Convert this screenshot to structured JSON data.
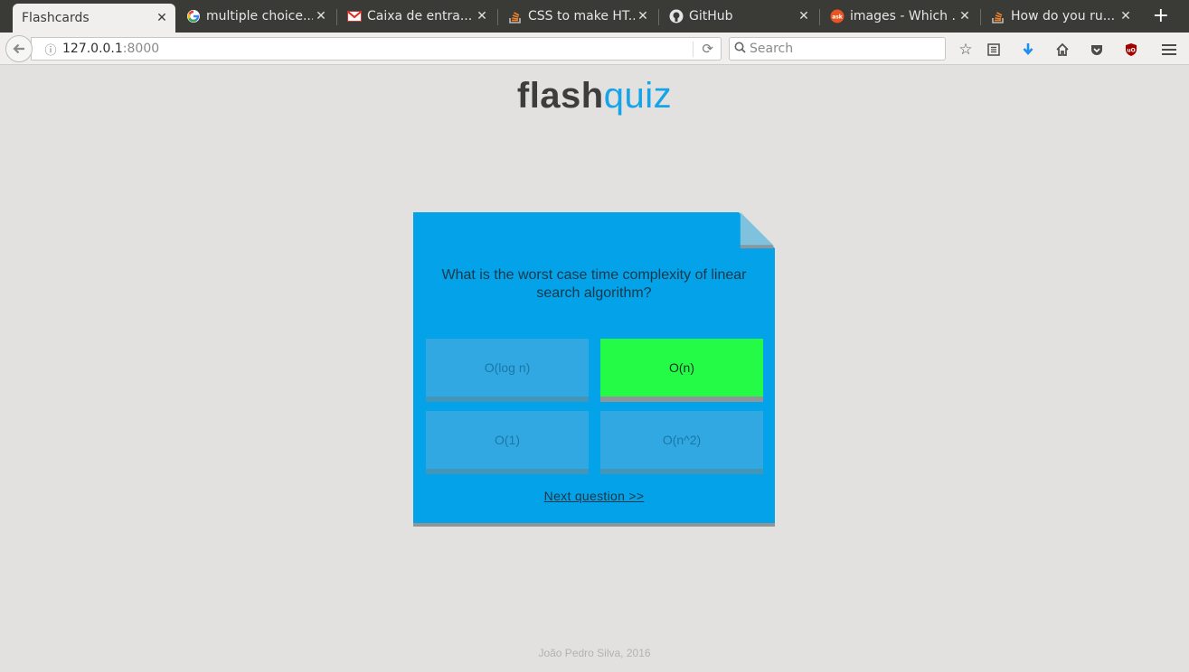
{
  "browser": {
    "tabs": [
      {
        "title": "Flashcards",
        "favicon": "none",
        "active": true
      },
      {
        "title": "multiple choice...",
        "favicon": "google-icon"
      },
      {
        "title": "Caixa de entra...",
        "favicon": "gmail-icon"
      },
      {
        "title": "CSS to make HT...",
        "favicon": "stackoverflow-icon"
      },
      {
        "title": "GitHub",
        "favicon": "github-icon"
      },
      {
        "title": "images - Which ...",
        "favicon": "askubuntu-icon"
      },
      {
        "title": "How do you ru...",
        "favicon": "stackoverflow-icon"
      }
    ],
    "new_tab": "+",
    "url_host": "127.0.0.1",
    "url_port": ":8000",
    "search_placeholder": "Search"
  },
  "app": {
    "logo_part1": "flash",
    "logo_part2": "quiz",
    "colors": {
      "card": "#04a2e8",
      "correct": "#24fb46",
      "logo_accent": "#16a4e8"
    }
  },
  "card": {
    "question": "What is the worst case time complexity of linear search algorithm?",
    "answers": [
      {
        "label": "O(log n)",
        "state": "dimmed"
      },
      {
        "label": "O(n)",
        "state": "correct"
      },
      {
        "label": "O(1)",
        "state": "dimmed"
      },
      {
        "label": "O(n^2)",
        "state": "dimmed"
      }
    ],
    "next_label": "Next question >>"
  },
  "footer": {
    "credit": "João Pedro Silva, 2016"
  }
}
